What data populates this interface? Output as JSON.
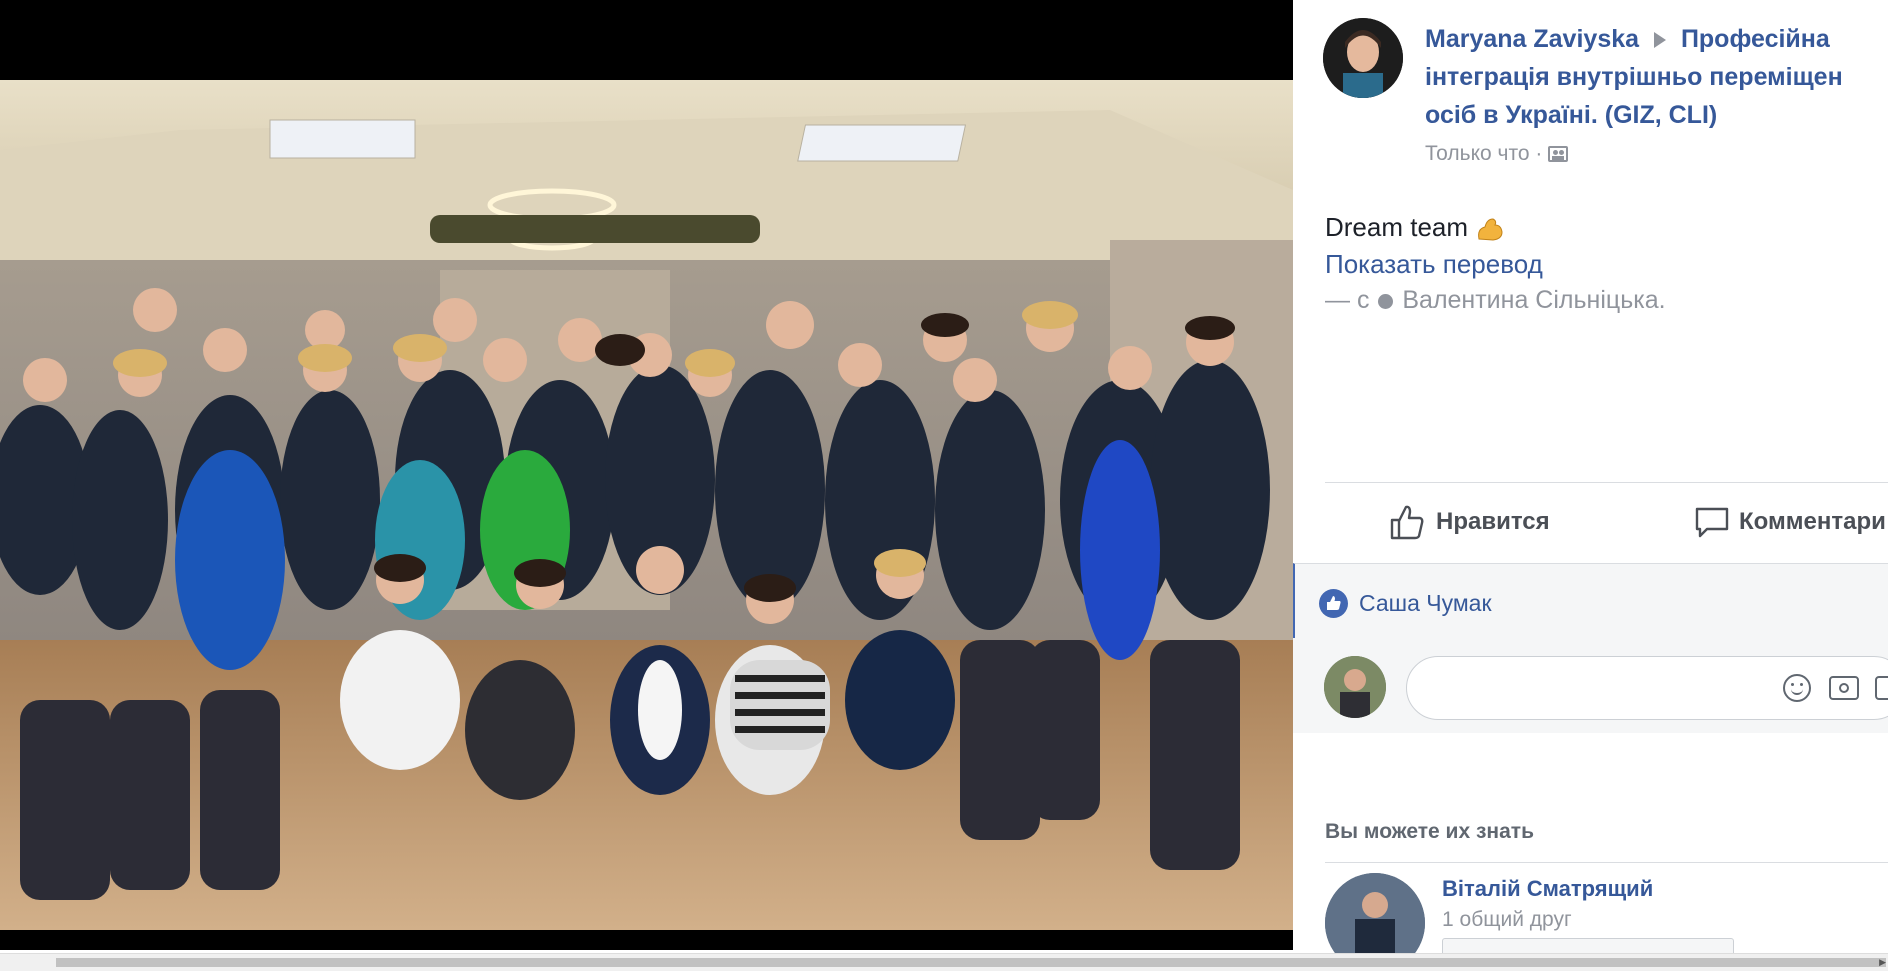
{
  "post": {
    "author": "Maryana Zaviyska",
    "separator_icon": "right-triangle-icon",
    "group_line1": "Професійна",
    "group_line2": "інтеграція внутрішньо переміщен",
    "group_line3": "осіб в Україні. (GIZ, CLI)",
    "time": "Только что",
    "time_separator": "·",
    "audience_icon": "audience-icon",
    "text": "Dream team",
    "emoji_icon": "flexed-biceps-icon",
    "translate_link": "Показать перевод",
    "with_prefix": "— с",
    "tagged_person": "Валентина Сільніцька."
  },
  "actions": {
    "like_label": "Нравится",
    "comment_label": "Комментари"
  },
  "reactions": {
    "liker": "Саша Чумак"
  },
  "comment_box": {
    "placeholder": "",
    "emoji_icon": "smiley-icon",
    "camera_icon": "camera-icon"
  },
  "suggestions": {
    "title": "Вы можете их знать",
    "person_name": "Віталій Сматрящий",
    "mutual": "1 общий друг"
  },
  "colors": {
    "link": "#365899",
    "muted": "#90949c",
    "like_blue": "#4267b2"
  }
}
